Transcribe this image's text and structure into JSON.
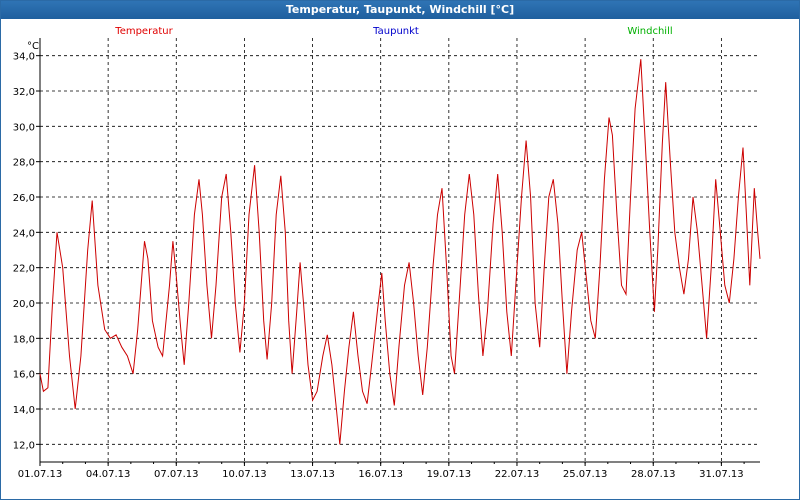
{
  "window": {
    "title": "Temperatur, Taupunkt, Windchill [°C]"
  },
  "chart_data": {
    "type": "line",
    "ylabel": "°C",
    "ylim": [
      11.0,
      35.0
    ],
    "y_ticks": [
      "12,0",
      "14,0",
      "16,0",
      "18,0",
      "20,0",
      "22,0",
      "24,0",
      "26,0",
      "28,0",
      "30,0",
      "32,0",
      "34,0"
    ],
    "x_ticks": [
      "01.07.13",
      "04.07.13",
      "07.07.13",
      "10.07.13",
      "13.07.13",
      "16.07.13",
      "19.07.13",
      "22.07.13",
      "25.07.13",
      "28.07.13",
      "31.07.13"
    ],
    "x_range_days": [
      0,
      31.7
    ],
    "grid": true,
    "legend": [
      {
        "name": "Temperatur",
        "color": "#e00000"
      },
      {
        "name": "Taupunkt",
        "color": "#0000cc"
      },
      {
        "name": "Windchill",
        "color": "#00b000"
      }
    ],
    "series": [
      {
        "name": "Temperatur",
        "color": "#cc0000",
        "points": [
          [
            0.0,
            16.0
          ],
          [
            0.15,
            15.0
          ],
          [
            0.35,
            15.2
          ],
          [
            0.55,
            20.0
          ],
          [
            0.75,
            24.0
          ],
          [
            1.0,
            22.0
          ],
          [
            1.3,
            17.0
          ],
          [
            1.55,
            14.0
          ],
          [
            1.8,
            17.0
          ],
          [
            2.1,
            23.0
          ],
          [
            2.3,
            25.8
          ],
          [
            2.55,
            21.0
          ],
          [
            2.85,
            18.5
          ],
          [
            3.1,
            18.0
          ],
          [
            3.35,
            18.2
          ],
          [
            3.6,
            17.5
          ],
          [
            3.85,
            17.0
          ],
          [
            4.1,
            16.0
          ],
          [
            4.3,
            18.5
          ],
          [
            4.45,
            21.0
          ],
          [
            4.6,
            23.5
          ],
          [
            4.75,
            22.5
          ],
          [
            4.95,
            19.0
          ],
          [
            5.2,
            17.5
          ],
          [
            5.4,
            17.0
          ],
          [
            5.7,
            21.0
          ],
          [
            5.85,
            23.5
          ],
          [
            6.0,
            21.5
          ],
          [
            6.2,
            18.5
          ],
          [
            6.35,
            16.5
          ],
          [
            6.55,
            20.0
          ],
          [
            6.8,
            25.0
          ],
          [
            7.0,
            27.0
          ],
          [
            7.15,
            25.0
          ],
          [
            7.35,
            21.0
          ],
          [
            7.55,
            18.0
          ],
          [
            7.75,
            21.0
          ],
          [
            8.0,
            26.0
          ],
          [
            8.2,
            27.3
          ],
          [
            8.4,
            24.0
          ],
          [
            8.6,
            20.0
          ],
          [
            8.8,
            17.2
          ],
          [
            9.0,
            20.0
          ],
          [
            9.2,
            25.0
          ],
          [
            9.45,
            27.8
          ],
          [
            9.65,
            24.0
          ],
          [
            9.85,
            19.0
          ],
          [
            10.0,
            16.8
          ],
          [
            10.2,
            20.0
          ],
          [
            10.4,
            25.0
          ],
          [
            10.6,
            27.2
          ],
          [
            10.8,
            24.0
          ],
          [
            10.95,
            19.0
          ],
          [
            11.1,
            16.0
          ],
          [
            11.3,
            19.5
          ],
          [
            11.45,
            22.3
          ],
          [
            11.6,
            20.0
          ],
          [
            11.8,
            16.5
          ],
          [
            12.0,
            14.5
          ],
          [
            12.2,
            15.0
          ],
          [
            12.45,
            17.0
          ],
          [
            12.65,
            18.2
          ],
          [
            12.85,
            16.5
          ],
          [
            13.05,
            14.0
          ],
          [
            13.2,
            12.0
          ],
          [
            13.4,
            15.0
          ],
          [
            13.6,
            17.5
          ],
          [
            13.8,
            19.5
          ],
          [
            14.0,
            17.0
          ],
          [
            14.2,
            15.0
          ],
          [
            14.4,
            14.3
          ],
          [
            14.6,
            16.5
          ],
          [
            14.85,
            19.5
          ],
          [
            15.05,
            21.7
          ],
          [
            15.2,
            19.0
          ],
          [
            15.4,
            16.0
          ],
          [
            15.6,
            14.2
          ],
          [
            15.8,
            17.5
          ],
          [
            16.05,
            21.0
          ],
          [
            16.25,
            22.3
          ],
          [
            16.45,
            20.0
          ],
          [
            16.65,
            17.0
          ],
          [
            16.85,
            14.8
          ],
          [
            17.05,
            17.5
          ],
          [
            17.3,
            22.0
          ],
          [
            17.5,
            25.0
          ],
          [
            17.7,
            26.5
          ],
          [
            17.9,
            22.0
          ],
          [
            18.1,
            17.0
          ],
          [
            18.25,
            16.0
          ],
          [
            18.45,
            20.0
          ],
          [
            18.7,
            25.0
          ],
          [
            18.9,
            27.3
          ],
          [
            19.1,
            25.0
          ],
          [
            19.3,
            20.5
          ],
          [
            19.5,
            17.0
          ],
          [
            19.7,
            19.5
          ],
          [
            19.95,
            24.5
          ],
          [
            20.15,
            27.3
          ],
          [
            20.35,
            24.0
          ],
          [
            20.55,
            19.5
          ],
          [
            20.75,
            17.0
          ],
          [
            20.95,
            21.0
          ],
          [
            21.2,
            26.0
          ],
          [
            21.4,
            29.2
          ],
          [
            21.6,
            26.0
          ],
          [
            21.8,
            20.0
          ],
          [
            22.0,
            17.5
          ],
          [
            22.2,
            22.0
          ],
          [
            22.4,
            26.0
          ],
          [
            22.6,
            27.0
          ],
          [
            22.8,
            24.5
          ],
          [
            23.0,
            20.0
          ],
          [
            23.2,
            16.0
          ],
          [
            23.4,
            19.5
          ],
          [
            23.65,
            23.0
          ],
          [
            23.85,
            24.0
          ],
          [
            24.05,
            21.5
          ],
          [
            24.25,
            19.0
          ],
          [
            24.45,
            18.0
          ],
          [
            24.65,
            22.0
          ],
          [
            24.85,
            27.0
          ],
          [
            25.05,
            30.5
          ],
          [
            25.2,
            29.5
          ],
          [
            25.4,
            25.0
          ],
          [
            25.6,
            21.0
          ],
          [
            25.8,
            20.5
          ],
          [
            26.0,
            26.0
          ],
          [
            26.2,
            31.0
          ],
          [
            26.45,
            33.8
          ],
          [
            26.65,
            29.0
          ],
          [
            26.85,
            24.0
          ],
          [
            27.05,
            19.5
          ],
          [
            27.2,
            23.0
          ],
          [
            27.4,
            29.0
          ],
          [
            27.55,
            32.5
          ],
          [
            27.75,
            28.0
          ],
          [
            27.95,
            24.0
          ],
          [
            28.15,
            22.0
          ],
          [
            28.35,
            20.5
          ],
          [
            28.55,
            22.5
          ],
          [
            28.75,
            26.0
          ],
          [
            28.95,
            24.0
          ],
          [
            29.15,
            21.0
          ],
          [
            29.35,
            18.0
          ],
          [
            29.55,
            22.0
          ],
          [
            29.75,
            27.0
          ],
          [
            29.95,
            24.0
          ],
          [
            30.15,
            21.0
          ],
          [
            30.35,
            20.0
          ],
          [
            30.55,
            22.5
          ],
          [
            30.75,
            26.0
          ],
          [
            30.95,
            28.8
          ],
          [
            31.1,
            25.0
          ],
          [
            31.25,
            21.0
          ],
          [
            31.45,
            26.5
          ],
          [
            31.6,
            24.0
          ],
          [
            31.7,
            22.5
          ]
        ]
      }
    ]
  }
}
